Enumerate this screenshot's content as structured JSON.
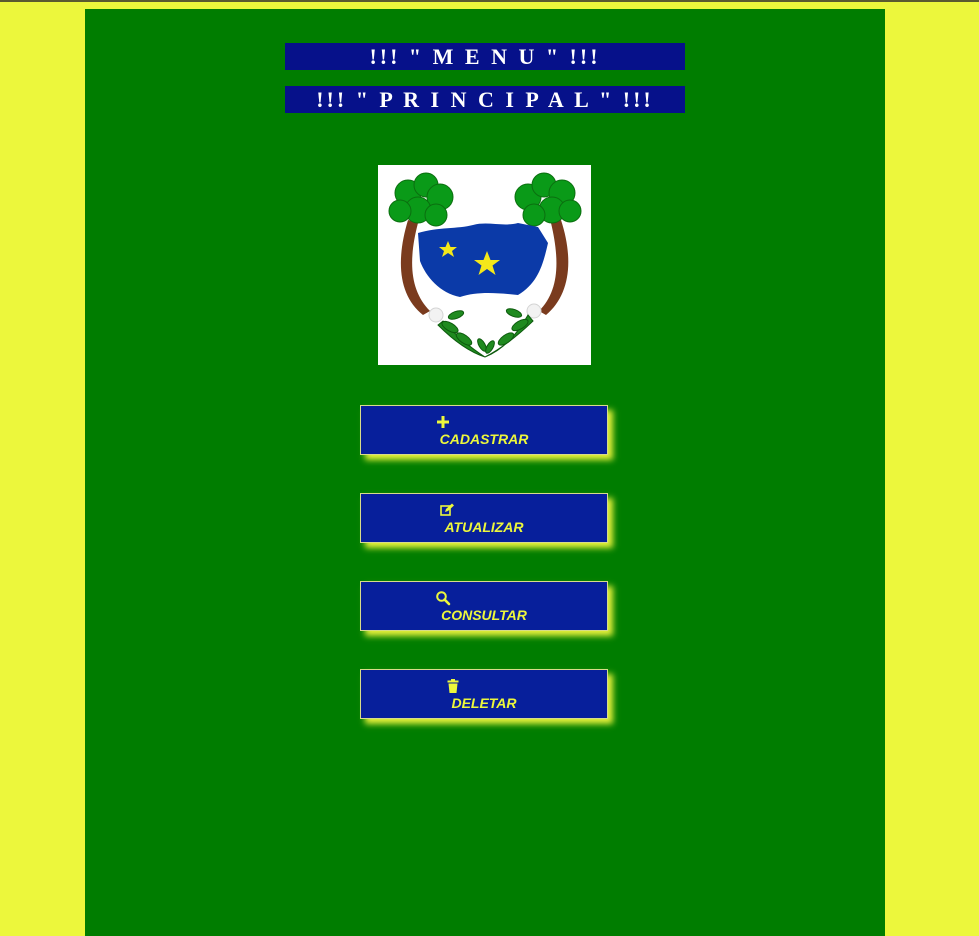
{
  "header": {
    "title_line_1": "!!! \" M E N U \" !!!",
    "title_line_2": "!!! \" P R I N C I P A L \" !!!"
  },
  "menu": {
    "buttons": [
      {
        "label": "CADASTRAR",
        "icon": "plus-icon"
      },
      {
        "label": "ATUALIZAR",
        "icon": "edit-icon"
      },
      {
        "label": "CONSULTAR",
        "icon": "search-icon"
      },
      {
        "label": "DELETAR",
        "icon": "trash-icon"
      }
    ]
  },
  "colors": {
    "page_background": "#ecf73c",
    "panel_background": "#007d00",
    "title_bar": "#06118a",
    "button_background": "#071f9b",
    "button_text": "#ecf73c"
  }
}
